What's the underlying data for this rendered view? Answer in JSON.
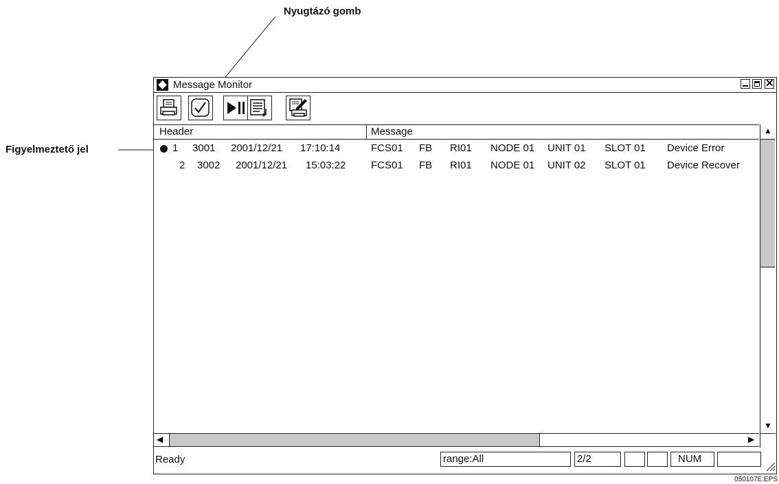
{
  "callouts": {
    "ack_button": "Nyugtázó gomb",
    "warning_mark": "Figyelmeztető jel"
  },
  "window": {
    "title": "Message Monitor"
  },
  "toolbar": {
    "icons": [
      "printer-icon",
      "check-icon",
      "play-pause-icon",
      "list-scroll-icon",
      "print-edit-icon"
    ]
  },
  "list": {
    "headers": [
      "Header",
      "Message"
    ],
    "rows": [
      {
        "alert": true,
        "num": "1",
        "code": "3001",
        "date": "2001/12/21",
        "time": "17:10:14",
        "station": "FCS01",
        "type": "FB",
        "rio": "RI01",
        "node": "NODE 01",
        "unit": "UNIT 01",
        "slot": "SLOT 01",
        "message": "Device Error"
      },
      {
        "alert": false,
        "num": "2",
        "code": "3002",
        "date": "2001/12/21",
        "time": "15:03:22",
        "station": "FCS01",
        "type": "FB",
        "rio": "RI01",
        "node": "NODE 01",
        "unit": "UNIT 02",
        "slot": "SLOT 01",
        "message": "Device Recover"
      }
    ]
  },
  "statusbar": {
    "ready": "Ready",
    "range": "range:All",
    "page": "2/2",
    "num": "NUM"
  },
  "figure_id": "050107E.EPS"
}
